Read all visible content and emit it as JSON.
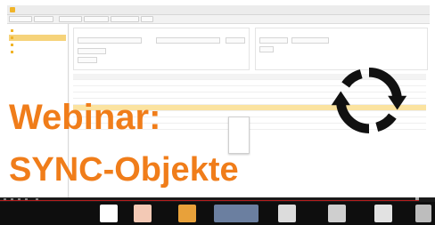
{
  "window": {
    "title": ""
  },
  "overlay": {
    "line1": "Webinar:",
    "line2": "SYNC-Objekte",
    "color": "#f07d1a"
  },
  "icons": {
    "sync": "sync-arrows-icon"
  },
  "colors": {
    "highlight_row": "#fbe3a0",
    "accent": "#f0b429",
    "taskbar": "#0e0e0e"
  }
}
